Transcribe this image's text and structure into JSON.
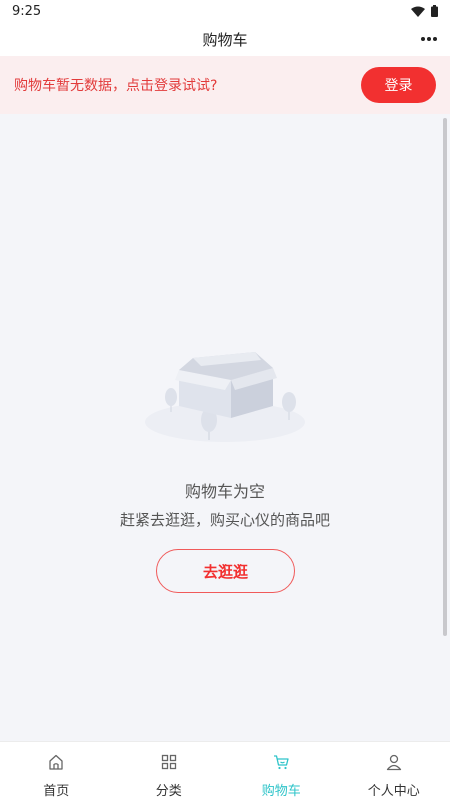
{
  "status_bar": {
    "time": "9:25"
  },
  "header": {
    "title": "购物车"
  },
  "login_banner": {
    "tip": "购物车暂无数据，点击登录试试?",
    "button_label": "登录"
  },
  "empty_state": {
    "title": "购物车为空",
    "subtitle": "赶紧去逛逛，购买心仪的商品吧",
    "button_label": "去逛逛"
  },
  "tab_bar": {
    "active": "cart",
    "items": [
      {
        "label": "首页",
        "icon": "home-icon"
      },
      {
        "label": "分类",
        "icon": "category-icon"
      },
      {
        "label": "购物车",
        "icon": "cart-icon"
      },
      {
        "label": "个人中心",
        "icon": "profile-icon"
      }
    ]
  },
  "colors": {
    "accent_red": "#f23030",
    "active_tab": "#2ec4c9",
    "banner_bg": "#fbeeef",
    "page_bg": "#f4f5f9"
  }
}
